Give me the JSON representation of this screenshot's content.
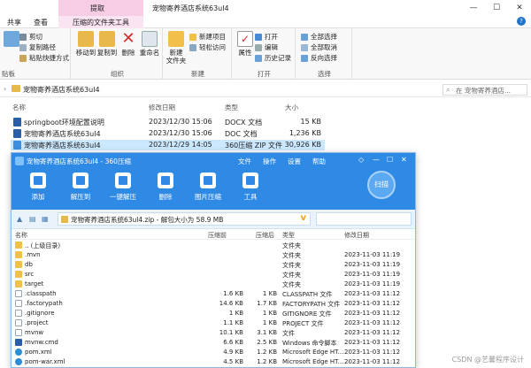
{
  "explorer": {
    "title": "宠物寄养酒店系统63ul4",
    "context_tab_header": "提取",
    "tabs": {
      "share": "共享",
      "view": "查看",
      "tools": "压缩的文件夹工具"
    },
    "window_controls": [
      "—",
      "☐",
      "✕"
    ],
    "help_icon": "?",
    "ribbon": {
      "clipboard": {
        "cut": "剪切",
        "copy_path": "复制路径",
        "paste_shortcut": "粘贴快捷方式",
        "group": "贴板"
      },
      "organize": {
        "move_to": "移动到",
        "copy_to": "复制到",
        "delete": "删除",
        "rename": "重命名",
        "group": "组织"
      },
      "new": {
        "new_folder": "新建\n文件夹",
        "new_item": "新建项目",
        "easy_access": "轻松访问",
        "group": "新建"
      },
      "open": {
        "properties": "属性",
        "open": "打开",
        "edit": "编辑",
        "history": "历史记录",
        "group": "打开"
      },
      "select": {
        "select_all": "全部选择",
        "select_none": "全部取消",
        "invert": "反向选择",
        "group": "选择"
      }
    },
    "address": {
      "path": "宠物寄养酒店系统63ul4",
      "search_placeholder": "在 宠物寄养酒店..."
    },
    "columns": {
      "name": "名称",
      "modified": "修改日期",
      "type": "类型",
      "size": "大小"
    },
    "files": [
      {
        "name": "springboot环境配置说明",
        "modified": "2023/12/30 15:06",
        "type": "DOCX 文档",
        "size": "15 KB",
        "icon": "word-icon"
      },
      {
        "name": "宠物寄养酒店系统63ul4",
        "modified": "2023/12/30 15:06",
        "type": "DOC 文档",
        "size": "1,236 KB",
        "icon": "word-icon"
      },
      {
        "name": "宠物寄养酒店系统63ul4",
        "modified": "2023/12/29 14:05",
        "type": "360压缩 ZIP 文件",
        "size": "30,926 KB",
        "icon": "zip-icon"
      }
    ],
    "watermark": "CSDN @艺馨程序设计"
  },
  "zip": {
    "title": "宠物寄养酒店系统63ul4 - 360压缩",
    "menu": [
      "文件",
      "操作",
      "设置",
      "帮助"
    ],
    "controls": [
      "—",
      "☐",
      "✕"
    ],
    "tools": [
      "添加",
      "解压到",
      "一键解压",
      "删除",
      "图片压缩",
      "工具"
    ],
    "badge": "扫描",
    "path": "宠物寄养酒店系统63ul4.zip - 解包大小为 58.9 MB",
    "columns": {
      "name": "名称",
      "compressed": "压缩前",
      "packed": "压缩后",
      "type": "类型",
      "modified": "修改日期"
    },
    "rows": [
      {
        "name": ".. (上级目录)",
        "compressed": "",
        "packed": "",
        "type": "文件夹",
        "modified": "",
        "kind": "folder"
      },
      {
        "name": ".mvn",
        "compressed": "",
        "packed": "",
        "type": "文件夹",
        "modified": "2023-11-03 11:19",
        "kind": "folder"
      },
      {
        "name": "db",
        "compressed": "",
        "packed": "",
        "type": "文件夹",
        "modified": "2023-11-03 11:19",
        "kind": "folder"
      },
      {
        "name": "src",
        "compressed": "",
        "packed": "",
        "type": "文件夹",
        "modified": "2023-11-03 11:19",
        "kind": "folder"
      },
      {
        "name": "target",
        "compressed": "",
        "packed": "",
        "type": "文件夹",
        "modified": "2023-11-03 11:19",
        "kind": "folder"
      },
      {
        "name": ".classpath",
        "compressed": "1.6 KB",
        "packed": "1 KB",
        "type": "CLASSPATH 文件",
        "modified": "2023-11-03 11:12",
        "kind": "file"
      },
      {
        "name": ".factorypath",
        "compressed": "14.6 KB",
        "packed": "1.7 KB",
        "type": "FACTORYPATH 文件",
        "modified": "2023-11-03 11:12",
        "kind": "file"
      },
      {
        "name": ".gitignore",
        "compressed": "1 KB",
        "packed": "1 KB",
        "type": "GITIGNORE 文件",
        "modified": "2023-11-03 11:12",
        "kind": "file"
      },
      {
        "name": ".project",
        "compressed": "1.1 KB",
        "packed": "1 KB",
        "type": "PROJECT 文件",
        "modified": "2023-11-03 11:12",
        "kind": "file"
      },
      {
        "name": "mvnw",
        "compressed": "10.1 KB",
        "packed": "3.1 KB",
        "type": "文件",
        "modified": "2023-11-03 11:12",
        "kind": "file"
      },
      {
        "name": "mvnw.cmd",
        "compressed": "6.6 KB",
        "packed": "2.5 KB",
        "type": "Windows 命令脚本",
        "modified": "2023-11-03 11:12",
        "kind": "win"
      },
      {
        "name": "pom.xml",
        "compressed": "4.9 KB",
        "packed": "1.2 KB",
        "type": "Microsoft Edge HT...",
        "modified": "2023-11-03 11:12",
        "kind": "edge"
      },
      {
        "name": "pom-war.xml",
        "compressed": "4.5 KB",
        "packed": "1.2 KB",
        "type": "Microsoft Edge HT...",
        "modified": "2023-11-03 11:12",
        "kind": "edge"
      }
    ]
  },
  "colors": {
    "zip_blue": "#2f8ae6",
    "context_pink": "#f7cde5",
    "selection": "#cce8ff"
  }
}
